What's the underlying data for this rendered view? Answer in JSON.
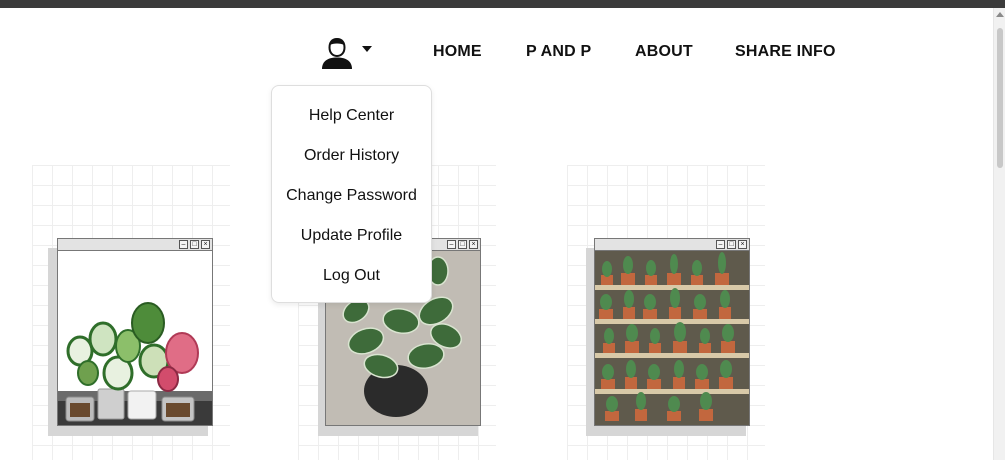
{
  "nav": {
    "user_icon": "user-avatar-icon",
    "caret_icon": "caret-down-icon",
    "links": [
      "HOME",
      "P AND P",
      "ABOUT",
      "SHARE INFO"
    ]
  },
  "dropdown": {
    "items": [
      "Help Center",
      "Order History",
      "Change Password",
      "Update Profile",
      "Log Out"
    ]
  },
  "window_buttons": {
    "minimize": "–",
    "maximize": "□",
    "close": "×"
  },
  "colors": {
    "topbar": "#3b3b3b",
    "text": "#111111",
    "grid": "#eeeeee"
  }
}
